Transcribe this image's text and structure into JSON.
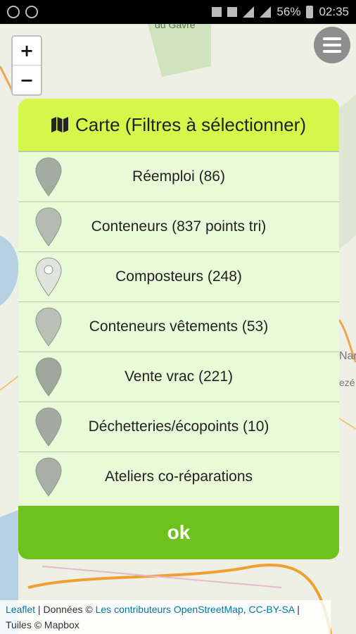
{
  "status_bar": {
    "battery": "56%",
    "time": "02:35"
  },
  "map": {
    "label_top": "du Gâvre",
    "label_right_1": "Nar",
    "label_right_2": "ezé",
    "zoom_in": "+",
    "zoom_out": "−"
  },
  "dialog": {
    "title": "Carte (Filtres à sélectionner)",
    "title_icon": "map-icon",
    "filters": [
      {
        "label": "Réemploi (86)",
        "pin_color": "#a3aca0"
      },
      {
        "label": "Conteneurs (837 points tri)",
        "pin_color": "#b4bcb1"
      },
      {
        "label": "Composteurs (248)",
        "pin_color": "#dfe4dc"
      },
      {
        "label": "Conteneurs vêtements (53)",
        "pin_color": "#b9c0b6"
      },
      {
        "label": "Vente vrac (221)",
        "pin_color": "#9fa69c"
      },
      {
        "label": "Déchetteries/écopoints (10)",
        "pin_color": "#a4aaa2"
      },
      {
        "label": "Ateliers co-réparations",
        "pin_color": "#a9aea7"
      }
    ],
    "ok_label": "ok"
  },
  "attribution": {
    "leaflet": "Leaflet",
    "sep1": " | Données © ",
    "osm": "Les contributeurs OpenStreetMap",
    "comma": ", ",
    "license": "CC-BY-SA",
    "sep2": " |",
    "tiles": "Tuiles © Mapbox"
  },
  "colors": {
    "header_bg": "#d4f74a",
    "dialog_bg": "#e8fad8",
    "ok_bg": "#6dc31b",
    "link": "#0078a8"
  }
}
